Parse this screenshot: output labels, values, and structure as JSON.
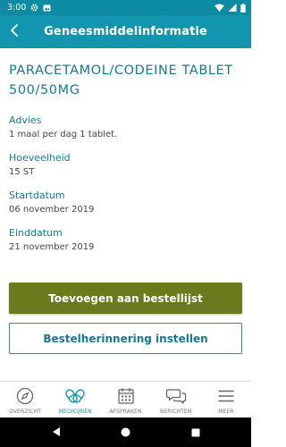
{
  "status_bar": {
    "time": "3:00"
  },
  "app_bar": {
    "title": "Geneesmiddelinformatie",
    "back_icon": "back-arrow-icon"
  },
  "medication": {
    "title": "PARACETAMOL/CODEINE TABLET 500/50MG",
    "fields": [
      {
        "label": "Advies",
        "value": "1 maal per dag 1 tablet."
      },
      {
        "label": "Hoeveelheid",
        "value": "15 ST"
      },
      {
        "label": "Startdatum",
        "value": "06 november 2019"
      },
      {
        "label": "Einddatum",
        "value": "21 november 2019"
      }
    ]
  },
  "actions": {
    "primary_label": "Toevoegen aan bestellijst",
    "secondary_label": "Bestelherinnering instellen"
  },
  "bottom_nav": {
    "items": [
      {
        "label": "OVERZICHT",
        "icon": "compass-icon",
        "active": false
      },
      {
        "label": "MEDICIJNEN",
        "icon": "pills-icon",
        "active": true
      },
      {
        "label": "AFSPRAKEN",
        "icon": "calendar-icon",
        "active": false
      },
      {
        "label": "BERICHTEN",
        "icon": "chat-icon",
        "active": false
      },
      {
        "label": "MEER",
        "icon": "menu-icon",
        "active": false
      }
    ]
  },
  "colors": {
    "header": "#1295ae",
    "status_bar": "#0d8ba3",
    "accent_text": "#157a90",
    "primary_button": "#6b7a1c"
  }
}
